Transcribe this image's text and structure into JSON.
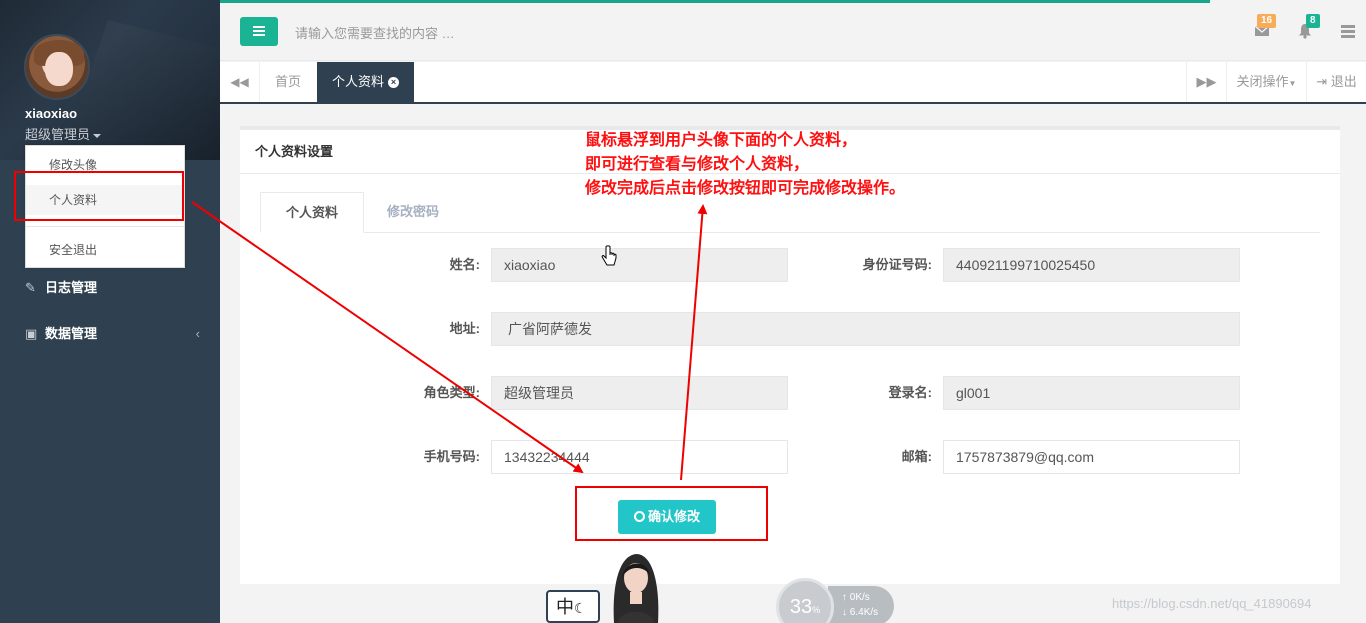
{
  "sidebar": {
    "username": "xiaoxiao",
    "role": "超级管理员",
    "dropdown": [
      {
        "label": "修改头像"
      },
      {
        "label": "个人资料"
      },
      {
        "label": "安全退出"
      }
    ],
    "nav": [
      {
        "label": "日志管理",
        "icon": "edit-icon"
      },
      {
        "label": "数据管理",
        "icon": "file-excel-icon",
        "arrow": "‹"
      }
    ]
  },
  "topbar": {
    "search_placeholder": "请输入您需要查找的内容 …",
    "mail_badge": "16",
    "bell_badge": "8",
    "mail_badge_color": "#f8ac59",
    "bell_badge_color": "#1ab394"
  },
  "tabs": {
    "home": "首页",
    "active": "个人资料",
    "close_ops": "关闭操作",
    "logout": "退出"
  },
  "panel": {
    "title": "个人资料设置",
    "inner_tabs": [
      "个人资料",
      "修改密码"
    ],
    "fields": {
      "name_label": "姓名:",
      "name_value": "xiaoxiao",
      "id_label": "身份证号码:",
      "id_value": "440921199710025450",
      "address_label": "地址:",
      "address_value": "广省阿萨德发",
      "role_label": "角色类型:",
      "role_value": "超级管理员",
      "login_label": "登录名:",
      "login_value": "gl001",
      "phone_label": "手机号码:",
      "phone_value": "13432234444",
      "email_label": "邮箱:",
      "email_value": "1757873879@qq.com"
    },
    "confirm_button": "确认修改"
  },
  "annotation": {
    "line1": "鼠标悬浮到用户头像下面的个人资料，",
    "line2": "即可进行查看与修改个人资料，",
    "line3": "修改完成后点击修改按钮即可完成修改操作。",
    "color": "#ff1010"
  },
  "overlay": {
    "ime": "中",
    "gauge_value": "33",
    "gauge_unit": "%",
    "upload_speed": "0",
    "download_speed": "6.4",
    "speed_unit": "K/s",
    "watermark": "https://blog.csdn.net/qq_41890694"
  }
}
